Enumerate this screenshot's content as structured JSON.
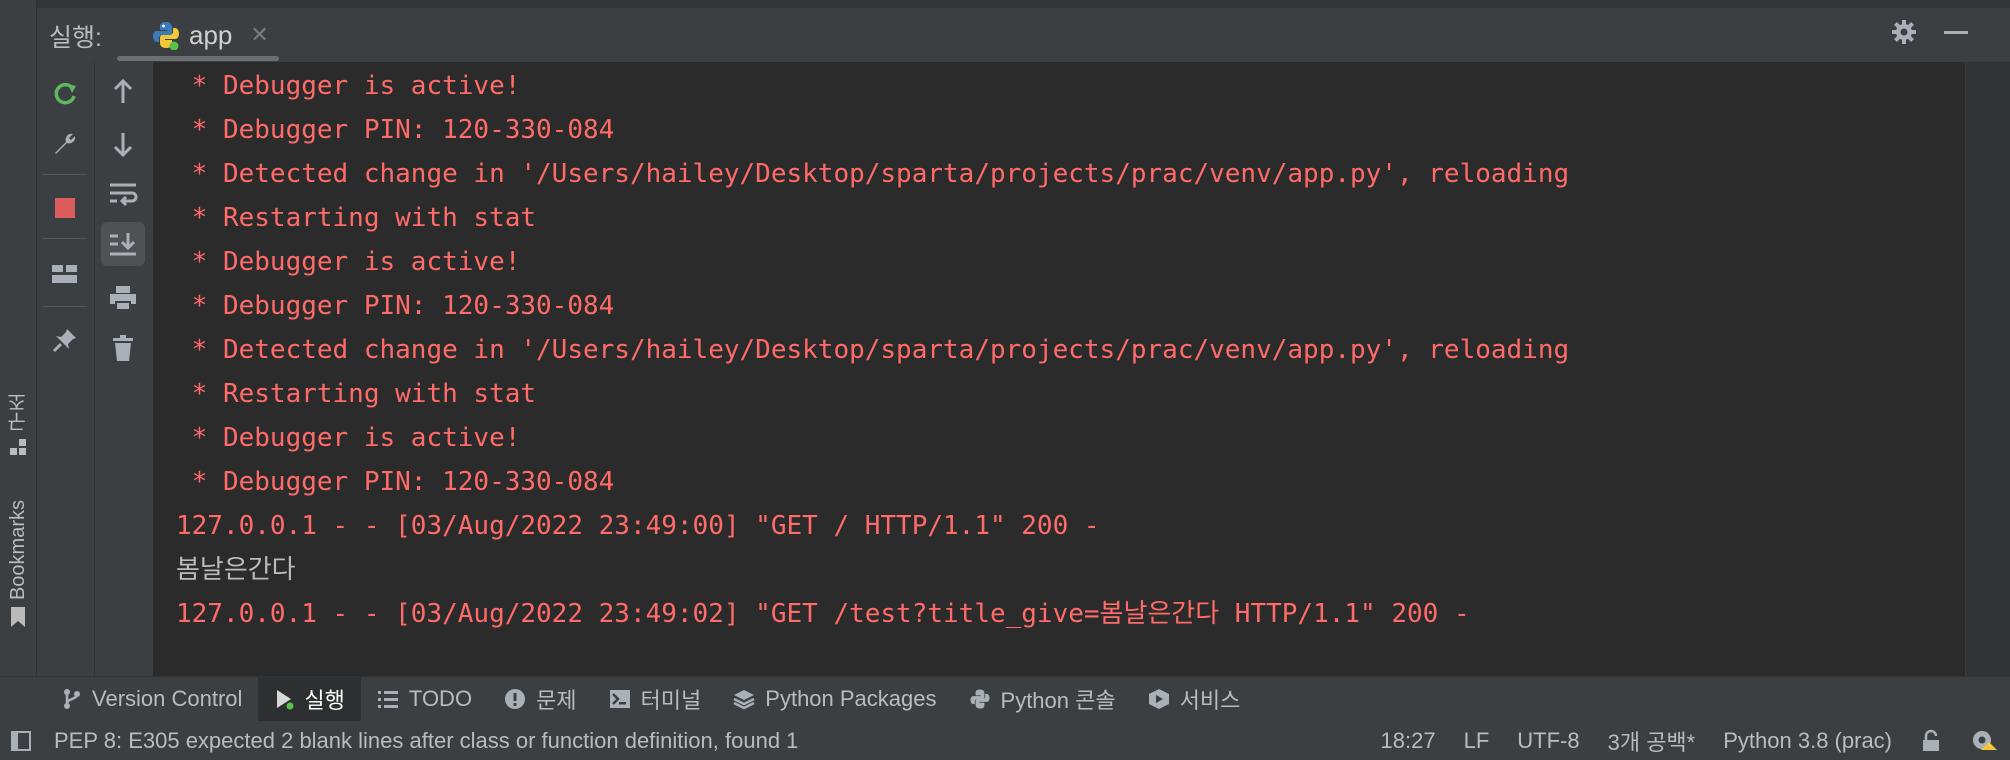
{
  "run_panel": {
    "title_prefix": "실행:",
    "tab": {
      "label": "app",
      "icon": "python-icon"
    }
  },
  "left_stripe": {
    "structure_label": "구조",
    "bookmarks_label": "Bookmarks"
  },
  "toolbar_primary": [
    "rerun-icon",
    "wrench-icon",
    "stop-icon",
    "layout-icon",
    "pin-icon"
  ],
  "toolbar_secondary": [
    "arrow-up-icon",
    "arrow-down-icon",
    "soft-wrap-icon",
    "scroll-to-end-icon",
    "print-icon",
    "trash-icon"
  ],
  "console": {
    "lines": [
      {
        "text": " * Debugger is active!",
        "kind": "err"
      },
      {
        "text": " * Debugger PIN: 120-330-084",
        "kind": "err"
      },
      {
        "text": " * Detected change in '/Users/hailey/Desktop/sparta/projects/prac/venv/app.py', reloading",
        "kind": "err"
      },
      {
        "text": " * Restarting with stat",
        "kind": "err"
      },
      {
        "text": " * Debugger is active!",
        "kind": "err"
      },
      {
        "text": " * Debugger PIN: 120-330-084",
        "kind": "err"
      },
      {
        "text": " * Detected change in '/Users/hailey/Desktop/sparta/projects/prac/venv/app.py', reloading",
        "kind": "err"
      },
      {
        "text": " * Restarting with stat",
        "kind": "err"
      },
      {
        "text": " * Debugger is active!",
        "kind": "err"
      },
      {
        "text": " * Debugger PIN: 120-330-084",
        "kind": "err"
      },
      {
        "text": "127.0.0.1 - - [03/Aug/2022 23:49:00] \"GET / HTTP/1.1\" 200 -",
        "kind": "err"
      },
      {
        "text": "봄날은간다",
        "kind": "out"
      },
      {
        "text": "127.0.0.1 - - [03/Aug/2022 23:49:02] \"GET /test?title_give=봄날은간다 HTTP/1.1\" 200 -",
        "kind": "err"
      }
    ]
  },
  "bottom_tabs": [
    {
      "label": "Version Control",
      "icon": "branch-icon",
      "selected": false
    },
    {
      "label": "실행",
      "icon": "run-icon",
      "selected": true
    },
    {
      "label": "TODO",
      "icon": "list-icon",
      "selected": false
    },
    {
      "label": "문제",
      "icon": "warning-icon",
      "selected": false
    },
    {
      "label": "터미널",
      "icon": "terminal-icon",
      "selected": false
    },
    {
      "label": "Python Packages",
      "icon": "layers-icon",
      "selected": false
    },
    {
      "label": "Python 콘솔",
      "icon": "python-icon",
      "selected": false
    },
    {
      "label": "서비스",
      "icon": "services-icon",
      "selected": false
    }
  ],
  "status_bar": {
    "message": "PEP 8: E305 expected 2 blank lines after class or function definition, found 1",
    "position": "18:27",
    "line_separator": "LF",
    "encoding": "UTF-8",
    "indent": "3개 공백*",
    "interpreter": "Python 3.8 (prac)"
  },
  "colors": {
    "error_text": "#ff6b68",
    "normal_text": "#bbbbbb",
    "background": "#2b2b2b",
    "panel": "#3c3f41"
  }
}
